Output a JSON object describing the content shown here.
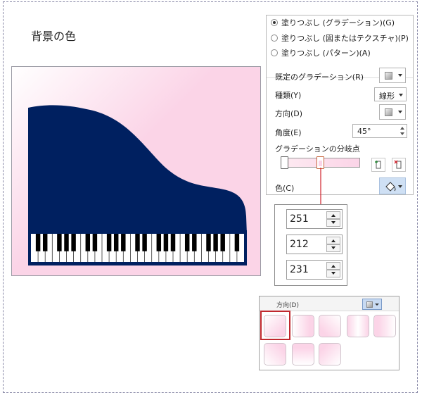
{
  "page": {
    "title": "背景の色"
  },
  "fill_pane": {
    "options": [
      {
        "label": "塗りつぶし (グラデーション)(G)",
        "selected": true
      },
      {
        "label": "塗りつぶし (図またはテクスチャ)(P)",
        "selected": false
      },
      {
        "label": "塗りつぶし (パターン)(A)",
        "selected": false
      }
    ],
    "preset_label": "既定のグラデーション(R)",
    "type_label": "種類(Y)",
    "type_value": "線形",
    "direction_label": "方向(D)",
    "angle_label": "角度(E)",
    "angle_value": "45°",
    "stops_label": "グラデーションの分岐点",
    "color_label": "色(C)"
  },
  "rgb": {
    "values": [
      "251",
      "212",
      "231"
    ]
  },
  "direction_gallery": {
    "label": "方向(D)"
  },
  "colors": {
    "piano_body": "#002060",
    "slide_pink": "#fbd4e7",
    "selection_red": "#c0282e",
    "arrow_red": "#d0202a"
  },
  "slide": {
    "white_key_count": 30
  }
}
